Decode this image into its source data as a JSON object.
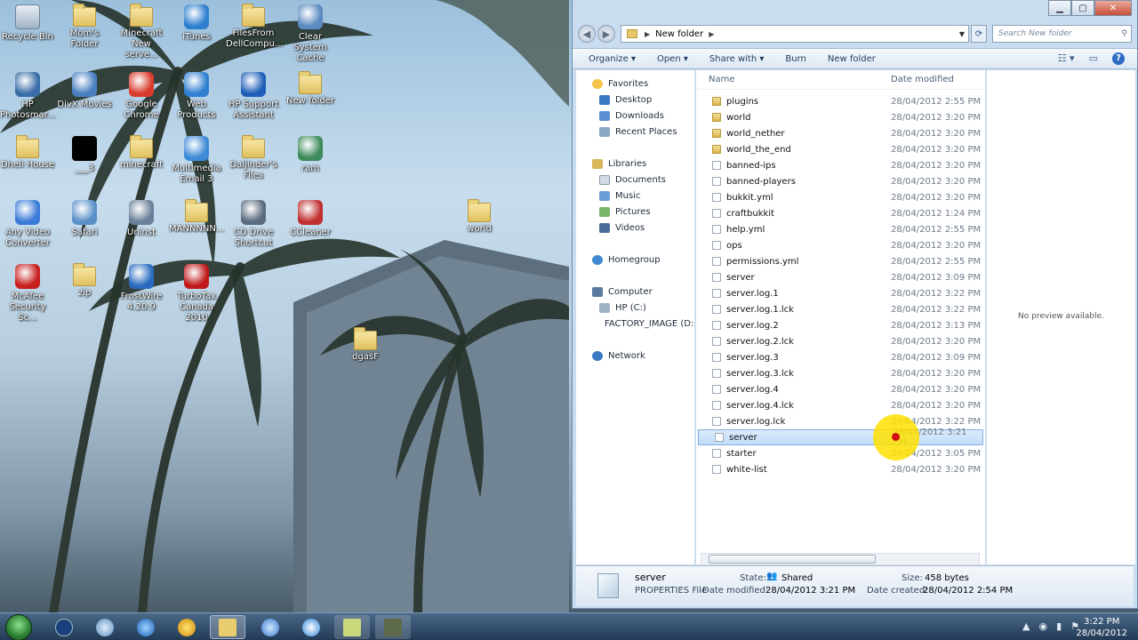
{
  "desktop": {
    "icons": [
      {
        "label": "Recycle Bin",
        "kind": "bin"
      },
      {
        "label": "Mom's Folder",
        "kind": "folder"
      },
      {
        "label": "Minecraft New serve...",
        "kind": "folder"
      },
      {
        "label": "iTunes",
        "kind": "app"
      },
      {
        "label": "FilesFrom DellCompu...",
        "kind": "folder"
      },
      {
        "label": "Clear System Cache",
        "kind": "app"
      },
      {
        "label": "HP Photosmar...",
        "kind": "app"
      },
      {
        "label": "DivX Movies",
        "kind": "app"
      },
      {
        "label": "Google Chrome",
        "kind": "app"
      },
      {
        "label": "Web Products",
        "kind": "app"
      },
      {
        "label": "HP Support Assistant",
        "kind": "app"
      },
      {
        "label": "New folder",
        "kind": "folder"
      },
      {
        "label": "Dheli House",
        "kind": "folder"
      },
      {
        "label": "___3",
        "kind": "black"
      },
      {
        "label": "minecraft",
        "kind": "folder"
      },
      {
        "label": "Multimedia Email 3",
        "kind": "app"
      },
      {
        "label": "Daljinder's Files",
        "kind": "folder"
      },
      {
        "label": "ram",
        "kind": "app"
      },
      {
        "label": "Any Video Converter",
        "kind": "app"
      },
      {
        "label": "Safari",
        "kind": "app"
      },
      {
        "label": "Uninst",
        "kind": "app"
      },
      {
        "label": "MANNNNN...",
        "kind": "folder"
      },
      {
        "label": "CD Drive Shortcut",
        "kind": "app"
      },
      {
        "label": "CCleaner",
        "kind": "app"
      },
      {
        "label": "world",
        "kind": "folder"
      },
      {
        "label": "McAfee Security Sc...",
        "kind": "app"
      },
      {
        "label": "zip",
        "kind": "folder"
      },
      {
        "label": "FrostWire 4.20.9",
        "kind": "app"
      },
      {
        "label": "TurboTax Canada 2010",
        "kind": "app"
      },
      {
        "label": "dgasF",
        "kind": "folder"
      }
    ]
  },
  "explorer": {
    "address": "New folder",
    "search_placeholder": "Search New folder",
    "toolbar": {
      "organize": "Organize ▾",
      "open": "Open ▾",
      "share": "Share with ▾",
      "burn": "Burn",
      "new_folder": "New folder"
    },
    "nav": {
      "favorites": "Favorites",
      "desktop": "Desktop",
      "downloads": "Downloads",
      "recent": "Recent Places",
      "libraries": "Libraries",
      "documents": "Documents",
      "music": "Music",
      "pictures": "Pictures",
      "videos": "Videos",
      "homegroup": "Homegroup",
      "computer": "Computer",
      "hp": "HP (C:)",
      "factory": "FACTORY_IMAGE (D:)",
      "network": "Network"
    },
    "columns": {
      "name": "Name",
      "date": "Date modified"
    },
    "files": [
      {
        "name": "plugins",
        "date": "28/04/2012 2:55 PM",
        "type": "folder"
      },
      {
        "name": "world",
        "date": "28/04/2012 3:20 PM",
        "type": "folder"
      },
      {
        "name": "world_nether",
        "date": "28/04/2012 3:20 PM",
        "type": "folder"
      },
      {
        "name": "world_the_end",
        "date": "28/04/2012 3:20 PM",
        "type": "folder"
      },
      {
        "name": "banned-ips",
        "date": "28/04/2012 3:20 PM",
        "type": "file"
      },
      {
        "name": "banned-players",
        "date": "28/04/2012 3:20 PM",
        "type": "file"
      },
      {
        "name": "bukkit.yml",
        "date": "28/04/2012 3:20 PM",
        "type": "file"
      },
      {
        "name": "craftbukkit",
        "date": "28/04/2012 1:24 PM",
        "type": "file"
      },
      {
        "name": "help.yml",
        "date": "28/04/2012 2:55 PM",
        "type": "file"
      },
      {
        "name": "ops",
        "date": "28/04/2012 3:20 PM",
        "type": "file"
      },
      {
        "name": "permissions.yml",
        "date": "28/04/2012 2:55 PM",
        "type": "file"
      },
      {
        "name": "server",
        "date": "28/04/2012 3:09 PM",
        "type": "file"
      },
      {
        "name": "server.log.1",
        "date": "28/04/2012 3:22 PM",
        "type": "file"
      },
      {
        "name": "server.log.1.lck",
        "date": "28/04/2012 3:22 PM",
        "type": "file"
      },
      {
        "name": "server.log.2",
        "date": "28/04/2012 3:13 PM",
        "type": "file"
      },
      {
        "name": "server.log.2.lck",
        "date": "28/04/2012 3:20 PM",
        "type": "file"
      },
      {
        "name": "server.log.3",
        "date": "28/04/2012 3:09 PM",
        "type": "file"
      },
      {
        "name": "server.log.3.lck",
        "date": "28/04/2012 3:20 PM",
        "type": "file"
      },
      {
        "name": "server.log.4",
        "date": "28/04/2012 3:20 PM",
        "type": "file"
      },
      {
        "name": "server.log.4.lck",
        "date": "28/04/2012 3:20 PM",
        "type": "file"
      },
      {
        "name": "server.log.lck",
        "date": "28/04/2012 3:22 PM",
        "type": "file"
      },
      {
        "name": "server",
        "date": "28/04/2012 3:21 PM",
        "type": "file",
        "selected": true
      },
      {
        "name": "starter",
        "date": "28/04/2012 3:05 PM",
        "type": "file"
      },
      {
        "name": "white-list",
        "date": "28/04/2012 3:20 PM",
        "type": "file"
      }
    ],
    "preview_text": "No preview available.",
    "details": {
      "name": "server",
      "type": "PROPERTIES File",
      "state_label": "State:",
      "state_value": "Shared",
      "size_label": "Size:",
      "size_value": "458 bytes",
      "modified_label": "Date modified:",
      "modified_value": "28/04/2012 3:21 PM",
      "created_label": "Date created:",
      "created_value": "28/04/2012 2:54 PM"
    }
  },
  "taskbar": {
    "time": "3:22 PM",
    "date": "28/04/2012"
  },
  "colors": {
    "selection": "#c1dcfa",
    "highlight_cursor": "#ffe000"
  }
}
